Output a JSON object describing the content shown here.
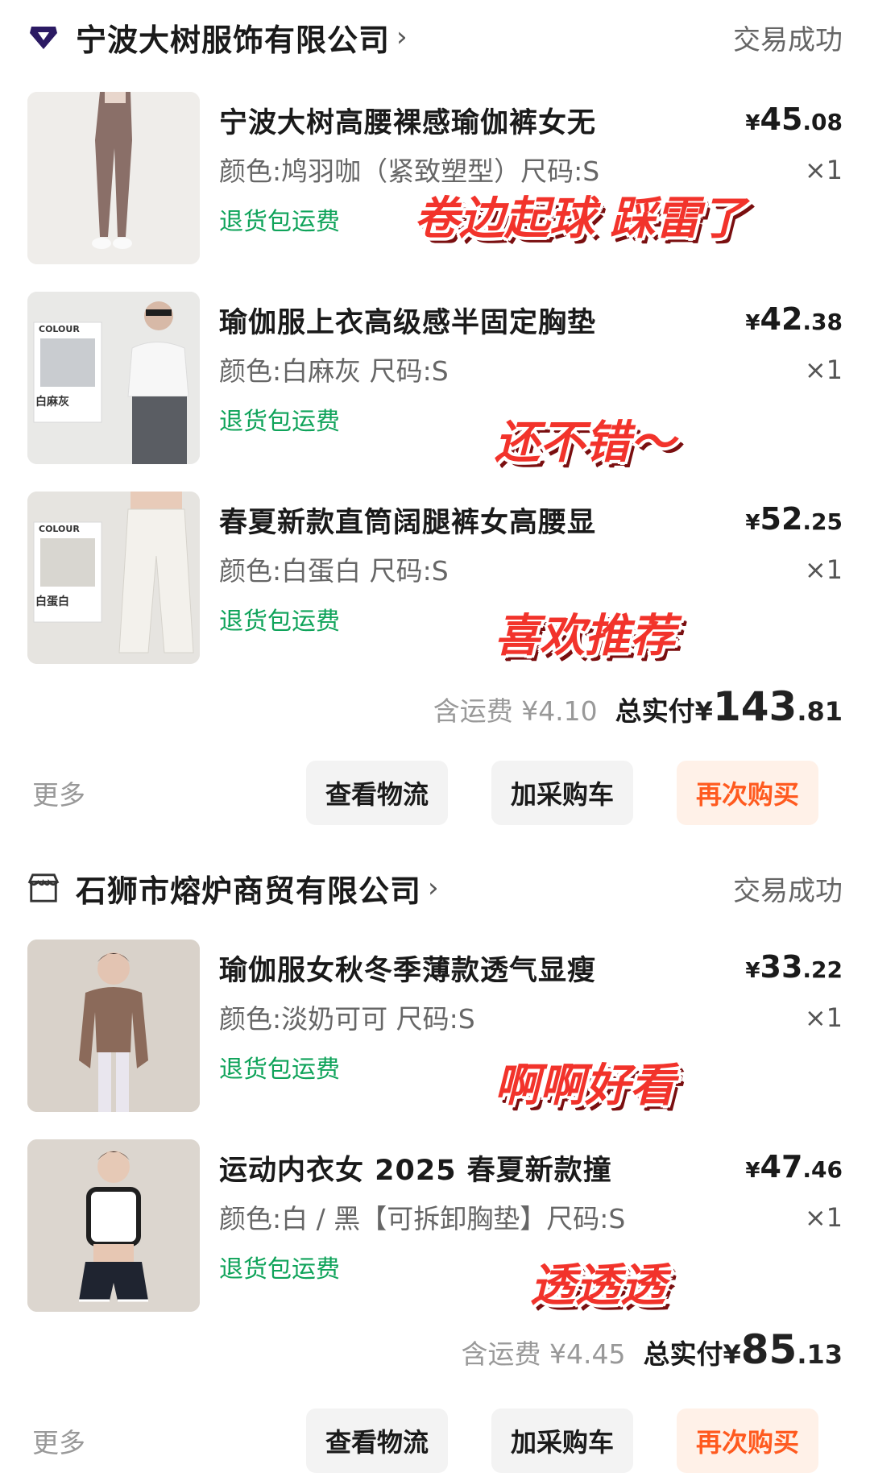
{
  "orders": [
    {
      "shop": {
        "name": "宁波大树服饰有限公司",
        "chevron": "›",
        "status": "交易成功",
        "icon": "brand-diamond-icon"
      },
      "items": [
        {
          "title": "宁波大树高腰裸感瑜伽裤女无",
          "spec": "颜色:鸠羽咖（紧致塑型）尺码:S",
          "return_label": "退货包运费",
          "price": {
            "cur": "¥",
            "int": "45",
            "dec": ".08"
          },
          "qty": "×1",
          "sticker": "卷边起球 踩雷了",
          "thumb_colors": [
            "#efedea",
            "#8a6f68"
          ]
        },
        {
          "title": "瑜伽服上衣高级感半固定胸垫",
          "spec": "颜色:白麻灰 尺码:S",
          "return_label": "退货包运费",
          "price": {
            "cur": "¥",
            "int": "42",
            "dec": ".38"
          },
          "qty": "×1",
          "sticker": "还不错～",
          "thumb_colors": [
            "#e9e9e7",
            "#f4f4f2"
          ],
          "thumb_text": {
            "brand": "COLOUR",
            "color": "白麻灰"
          }
        },
        {
          "title": "春夏新款直筒阔腿裤女高腰显",
          "spec": "颜色:白蛋白 尺码:S",
          "return_label": "退货包运费",
          "price": {
            "cur": "¥",
            "int": "52",
            "dec": ".25"
          },
          "qty": "×1",
          "sticker": "喜欢推荐",
          "thumb_colors": [
            "#e6e4e0",
            "#f1efea"
          ],
          "thumb_text": {
            "brand": "COLOUR",
            "color": "白蛋白"
          }
        }
      ],
      "shipping": "含运费 ¥4.10",
      "total_label": "总实付",
      "total": {
        "cur": "¥",
        "int": "143",
        "dec": ".81"
      },
      "actions": {
        "more": "更多",
        "logistics": "查看物流",
        "add_cart": "加采购车",
        "buy_again": "再次购买"
      }
    },
    {
      "shop": {
        "name": "石狮市熔炉商贸有限公司",
        "chevron": "›",
        "status": "交易成功",
        "icon": "store-icon"
      },
      "items": [
        {
          "title": "瑜伽服女秋冬季薄款透气显瘦",
          "spec": "颜色:淡奶可可 尺码:S",
          "return_label": "退货包运费",
          "price": {
            "cur": "¥",
            "int": "33",
            "dec": ".22"
          },
          "qty": "×1",
          "sticker": "啊啊好看",
          "thumb_colors": [
            "#d9d2ca",
            "#8b6a5a"
          ]
        },
        {
          "title": "运动内衣女 2025 春夏新款撞",
          "spec": "颜色:白 / 黑【可拆卸胸垫】尺码:S",
          "return_label": "退货包运费",
          "price": {
            "cur": "¥",
            "int": "47",
            "dec": ".46"
          },
          "qty": "×1",
          "sticker": "透透透",
          "thumb_colors": [
            "#dcd6cf",
            "#f5f5f5"
          ]
        }
      ],
      "shipping": "含运费 ¥4.45",
      "total_label": "总实付",
      "total": {
        "cur": "¥",
        "int": "85",
        "dec": ".13"
      },
      "actions": {
        "more": "更多",
        "logistics": "查看物流",
        "add_cart": "加采购车",
        "buy_again": "再次购买"
      }
    }
  ]
}
